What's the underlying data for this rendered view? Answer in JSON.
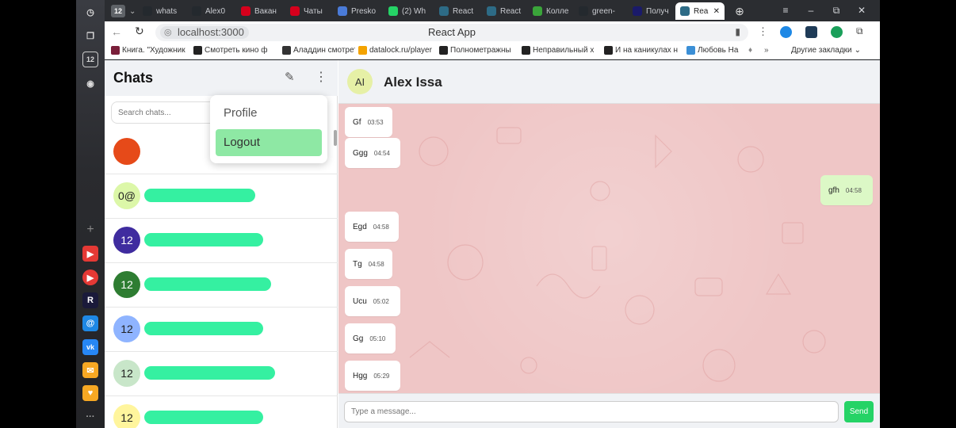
{
  "browser": {
    "tab_counter": "12",
    "tabs": [
      {
        "label": "whats",
        "icon": "github-icon",
        "color": "#24292e"
      },
      {
        "label": "Alex0",
        "icon": "github-icon",
        "color": "#24292e"
      },
      {
        "label": "Вакан",
        "icon": "hh-icon",
        "color": "#d6001c"
      },
      {
        "label": "Чаты",
        "icon": "hh-icon",
        "color": "#d6001c"
      },
      {
        "label": "Presko",
        "icon": "presko-icon",
        "color": "#4a7bd8"
      },
      {
        "label": "(2) Wh",
        "icon": "whatsapp-icon",
        "color": "#25d366"
      },
      {
        "label": "React",
        "icon": "react-icon",
        "color": "#2d6b86"
      },
      {
        "label": "React",
        "icon": "react-icon",
        "color": "#2d6b86"
      },
      {
        "label": "Колле",
        "icon": "collection-icon",
        "color": "#3aa53a"
      },
      {
        "label": "green-",
        "icon": "github-icon",
        "color": "#24292e"
      },
      {
        "label": "Получ",
        "icon": "r-icon",
        "color": "#1a1a6a"
      },
      {
        "label": "Rea",
        "icon": "react-icon",
        "color": "#2d6b86"
      }
    ],
    "url": "localhost:3000",
    "page_title": "React App",
    "bookmarks": [
      {
        "label": "Книга. \"Художник",
        "color": "#7a1f3a"
      },
      {
        "label": "Смотреть кино ф",
        "color": "#222"
      },
      {
        "label": "Аладдин смотрет",
        "color": "#333"
      },
      {
        "label": "datalock.ru/player",
        "color": "#f4a300"
      },
      {
        "label": "Полнометражны",
        "color": "#222"
      },
      {
        "label": "Неправильный х",
        "color": "#222"
      },
      {
        "label": "И на каникулах н",
        "color": "#222"
      },
      {
        "label": "Любовь На",
        "color": "#3b8fd6"
      }
    ],
    "other_bookmarks": "Другие закладки"
  },
  "chatlist": {
    "title": "Chats",
    "search_placeholder": "Search chats...",
    "menu": {
      "profile": "Profile",
      "logout": "Logout"
    },
    "items": [
      {
        "avatar": "",
        "color": "#e64a19"
      },
      {
        "avatar": "0@",
        "color": "#dcf7a8"
      },
      {
        "avatar": "12",
        "color": "#3f2c9f",
        "text_color": "#ffffff"
      },
      {
        "avatar": "12",
        "color": "#2e7d32",
        "text_color": "#ffffff"
      },
      {
        "avatar": "12",
        "color": "#8fb4ff"
      },
      {
        "avatar": "12",
        "color": "#c8e6c9"
      },
      {
        "avatar": "12",
        "color": "#fff59d"
      }
    ]
  },
  "chat": {
    "contact_initials": "AI",
    "contact_name": "Alex Issa",
    "messages": [
      {
        "text": "Gf",
        "time": "03:53",
        "dir": "in"
      },
      {
        "text": "Ggg",
        "time": "04:54",
        "dir": "in"
      },
      {
        "text": "gfh",
        "time": "04:58",
        "dir": "out"
      },
      {
        "text": "Egd",
        "time": "04:58",
        "dir": "in"
      },
      {
        "text": "Tg",
        "time": "04:58",
        "dir": "in"
      },
      {
        "text": "Ucu",
        "time": "05:02",
        "dir": "in"
      },
      {
        "text": "Gg",
        "time": "05:10",
        "dir": "in"
      },
      {
        "text": "Hgg",
        "time": "05:29",
        "dir": "in"
      }
    ],
    "input_placeholder": "Type a message...",
    "send_label": "Send"
  }
}
